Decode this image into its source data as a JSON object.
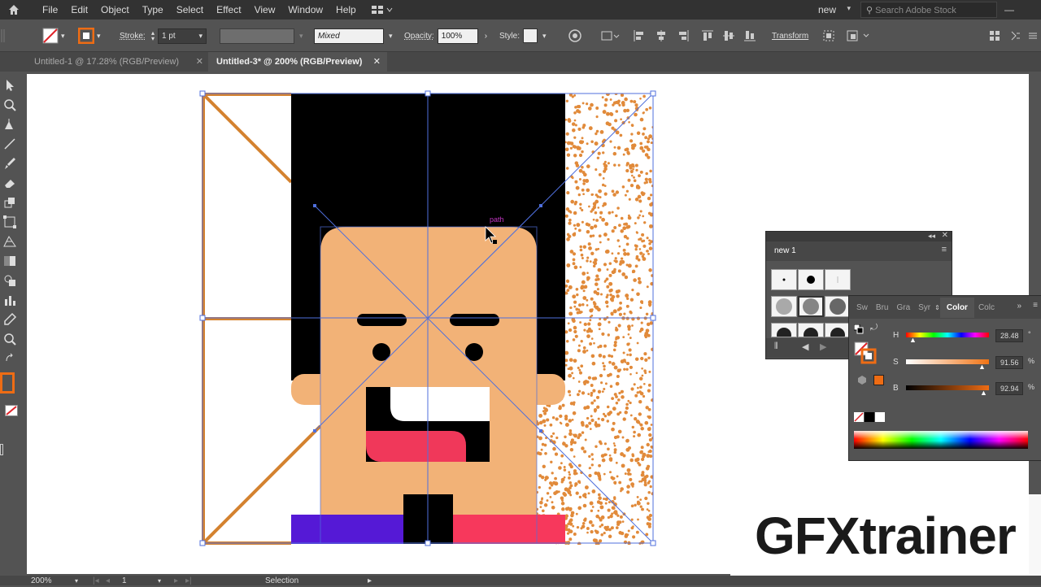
{
  "menu": {
    "items": [
      "File",
      "Edit",
      "Object",
      "Type",
      "Select",
      "Effect",
      "View",
      "Window",
      "Help"
    ],
    "workspace": "new",
    "search_placeholder": "Search Adobe Stock"
  },
  "control": {
    "stroke_label": "Stroke:",
    "stroke_value": "1 pt",
    "blend": "Mixed",
    "opacity_label": "Opacity:",
    "opacity_value": "100%",
    "style_label": "Style:",
    "transform_label": "Transform"
  },
  "tabs": [
    {
      "label": "Untitled-1 @ 17.28% (RGB/Preview)",
      "active": false
    },
    {
      "label": "Untitled-3* @ 200% (RGB/Preview)",
      "active": true
    }
  ],
  "canvas": {
    "hover_label": "path"
  },
  "brush_panel": {
    "title": "new 1"
  },
  "color_panel": {
    "tabs": [
      "Sw",
      "Bru",
      "Gra",
      "Syr",
      "Color",
      "Colc"
    ],
    "active_tab": "Color",
    "h_label": "H",
    "h_value": "28.48",
    "h_unit": "°",
    "s_label": "S",
    "s_value": "91.56",
    "s_unit": "%",
    "b_label": "B",
    "b_value": "92.94",
    "b_unit": "%"
  },
  "status": {
    "zoom": "200%",
    "artboard": "1",
    "tool": "Selection"
  },
  "watermark": "GFXtrainer",
  "colors": {
    "orange_stroke": "#d4822f",
    "skin": "#f2b277",
    "hair": "#000000",
    "mouth": "#f0385a",
    "shirt_left": "#5519d6",
    "shirt_right": "#f7385c",
    "selection": "#4f6fdc",
    "fill_swatch": "#ee6c14"
  }
}
